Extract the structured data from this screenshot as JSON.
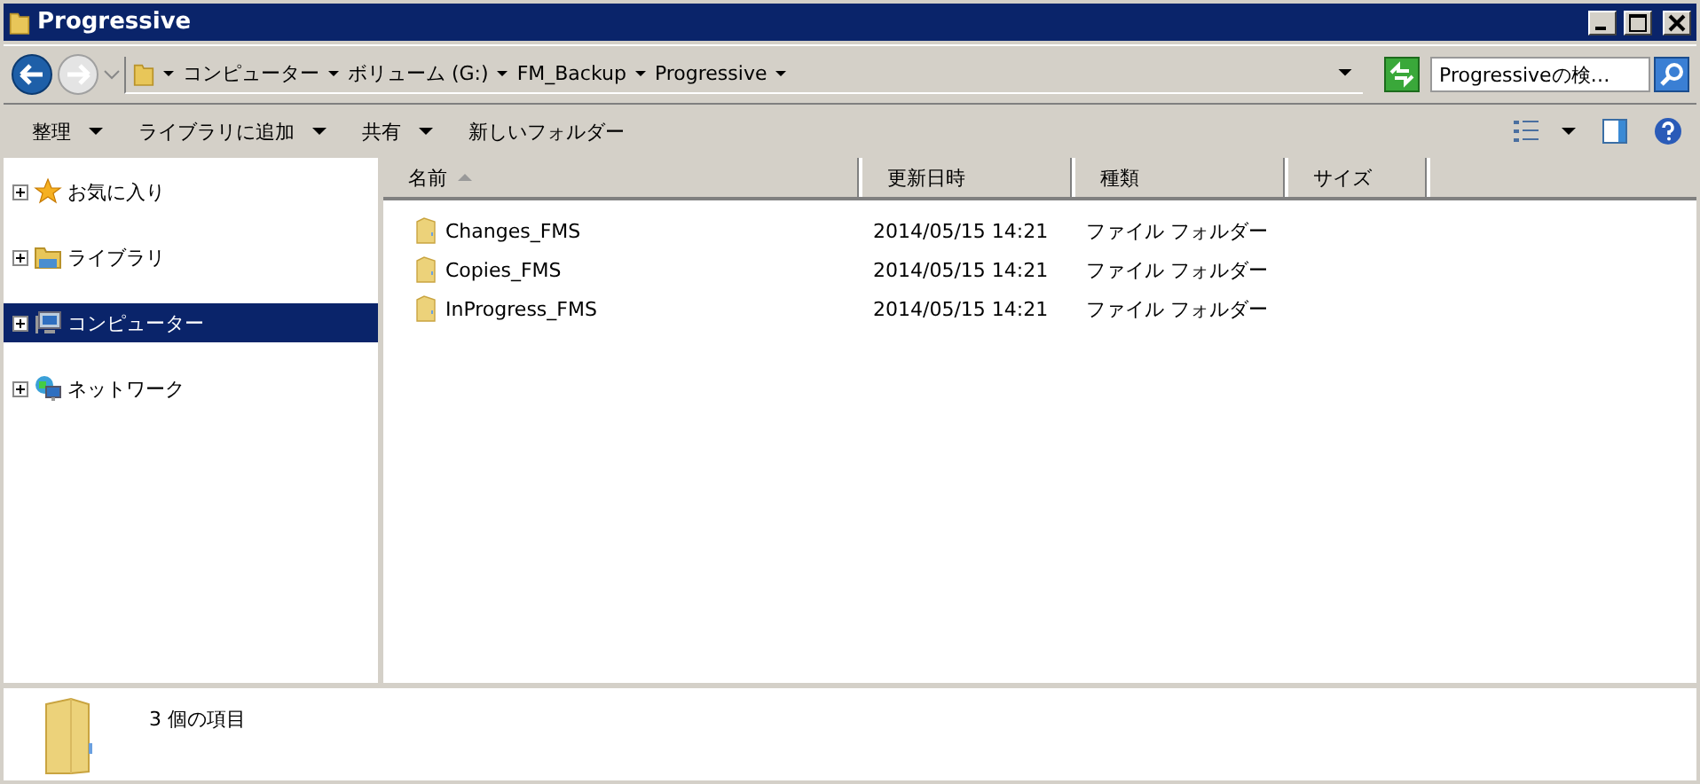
{
  "window": {
    "title": "Progressive"
  },
  "breadcrumb": [
    "コンピューター",
    "ボリューム (G:)",
    "FM_Backup",
    "Progressive"
  ],
  "search": {
    "placeholder": "Progressiveの検…"
  },
  "toolbar": [
    {
      "label": "整理",
      "has_menu": true
    },
    {
      "label": "ライブラリに追加",
      "has_menu": true
    },
    {
      "label": "共有",
      "has_menu": true
    },
    {
      "label": "新しいフォルダー",
      "has_menu": false
    }
  ],
  "sidebar": {
    "items": [
      {
        "label": "お気に入り",
        "kind": "star",
        "selected": false
      },
      {
        "label": "ライブラリ",
        "kind": "library",
        "selected": false
      },
      {
        "label": "コンピューター",
        "kind": "computer",
        "selected": true
      },
      {
        "label": "ネットワーク",
        "kind": "network",
        "selected": false
      }
    ]
  },
  "table": {
    "columns": [
      {
        "label": "名前",
        "sorted": true
      },
      {
        "label": "更新日時",
        "sorted": false
      },
      {
        "label": "種類",
        "sorted": false
      },
      {
        "label": "サイズ",
        "sorted": false
      }
    ],
    "rows": [
      {
        "name": "Changes_FMS",
        "modified": "2014/05/15 14:21",
        "type": "ファイル フォルダー"
      },
      {
        "name": "Copies_FMS",
        "modified": "2014/05/15 14:21",
        "type": "ファイル フォルダー"
      },
      {
        "name": "InProgress_FMS",
        "modified": "2014/05/15 14:21",
        "type": "ファイル フォルダー"
      }
    ]
  },
  "status_bar": {
    "text": "3 個の項目"
  }
}
